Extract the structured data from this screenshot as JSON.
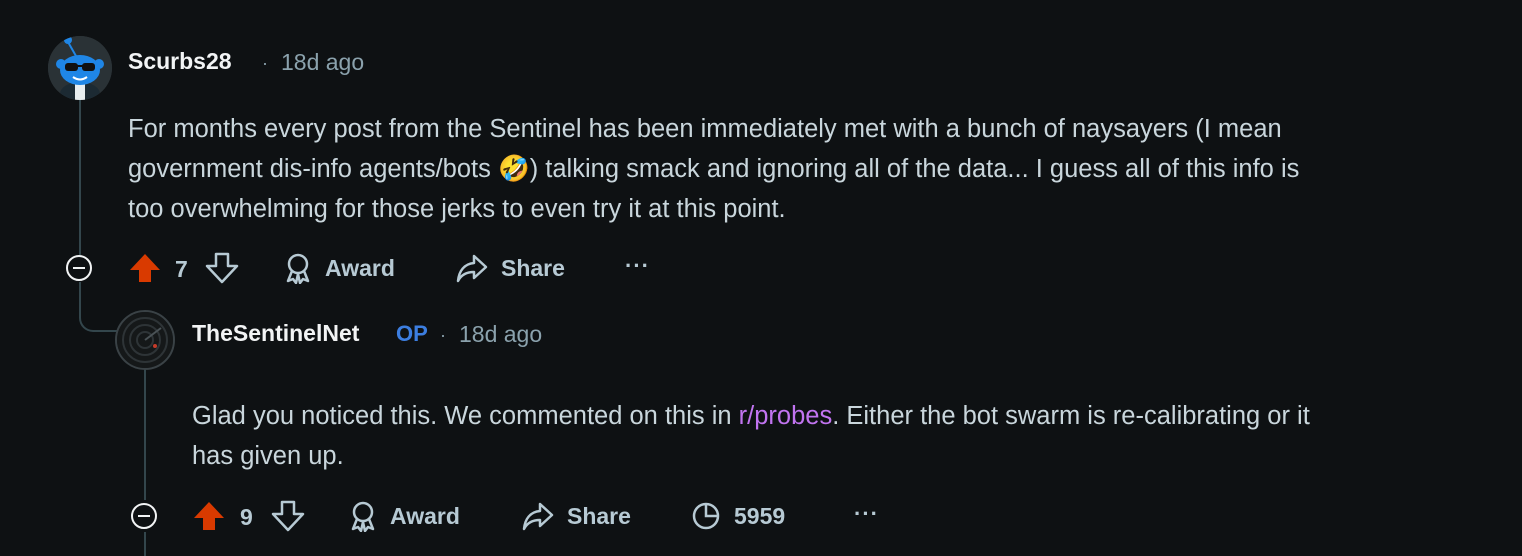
{
  "comments": [
    {
      "username": "Scurbs28",
      "separator": "·",
      "time": "18d ago",
      "body_lines": [
        "For months every post from the Sentinel has been immediately met with a bunch of naysayers (I mean",
        "government dis-info agents/bots 🤣) talking smack and ignoring all of the data... I guess all of this info is",
        "too overwhelming for those jerks to even try it at this point."
      ],
      "score": "7",
      "award_label": "Award",
      "share_label": "Share",
      "more_label": "···"
    },
    {
      "username": "TheSentinelNet",
      "op_badge": "OP",
      "separator": "·",
      "time": "18d ago",
      "body_before_link": "Glad you noticed this. We commented on this in ",
      "body_link": "r/probes",
      "body_after_link": ". Either the bot swarm is re-calibrating or it",
      "body_line2": "has given up.",
      "score": "9",
      "award_label": "Award",
      "share_label": "Share",
      "insights_count": "5959",
      "more_label": "···"
    }
  ],
  "colors": {
    "background": "#0e1113",
    "upvote_active": "#d93a00",
    "op_badge": "#3c7ee0",
    "link": "#c174f0"
  }
}
